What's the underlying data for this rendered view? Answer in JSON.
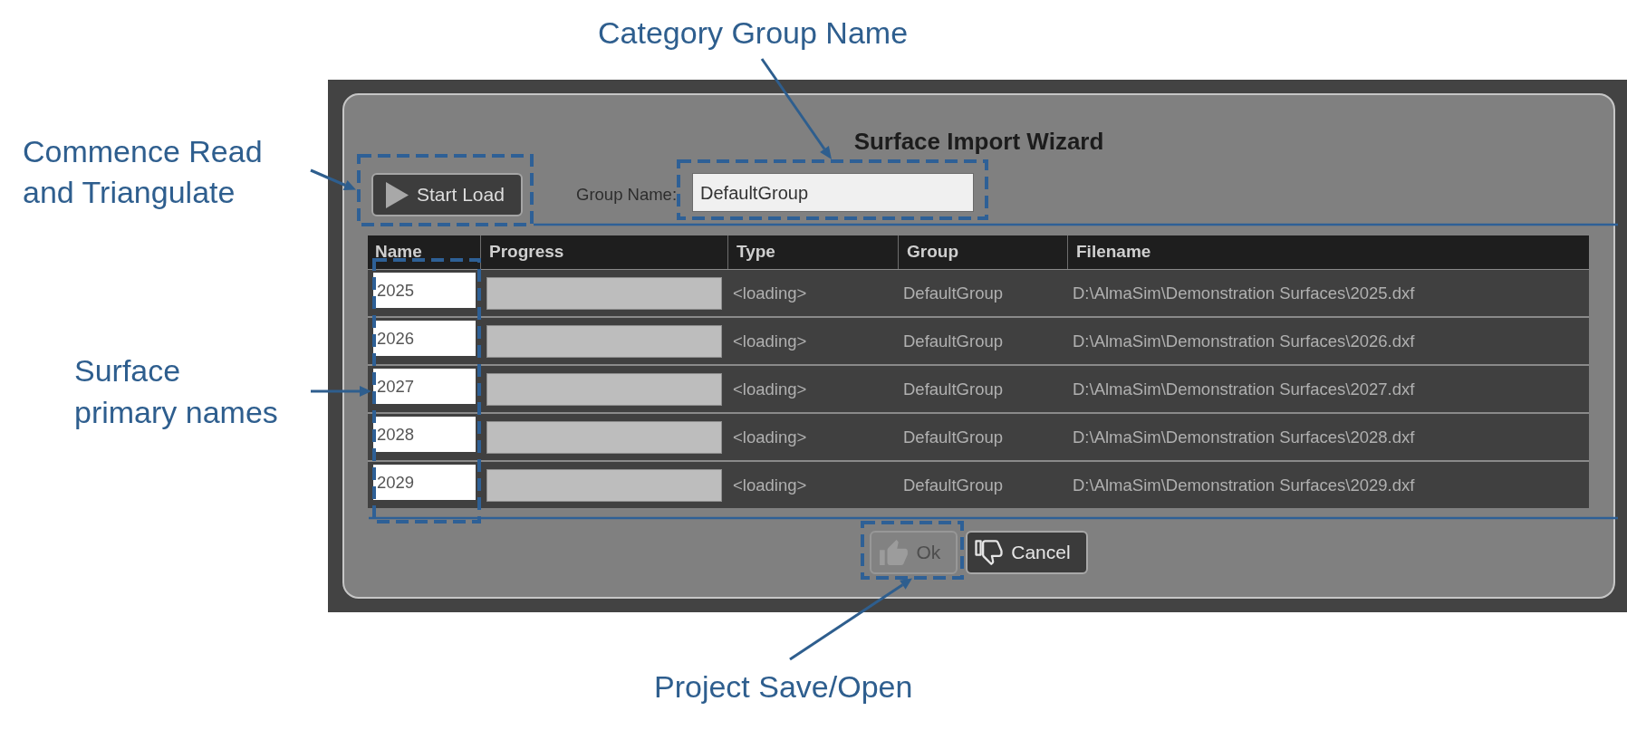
{
  "callouts": [
    {
      "text": "Category Group Name"
    },
    {
      "text": "Commence Read and Triangulate"
    },
    {
      "text": "Surface primary names"
    },
    {
      "text": "Project Save/Open"
    }
  ],
  "dialog": {
    "title": "Surface Import Wizard",
    "start_button": {
      "label": "Start Load"
    },
    "group_name": {
      "label": "Group Name:",
      "value": "DefaultGroup"
    },
    "table": {
      "columns": [
        "Name",
        "Progress",
        "Type",
        "Group",
        "Filename"
      ],
      "rows": [
        {
          "name": "2025",
          "progress": {
            "level": 0
          },
          "type": "<loading>",
          "group": "DefaultGroup",
          "filename": "D:\\AlmaSim\\Demonstration Surfaces\\2025.dxf"
        },
        {
          "name": "2026",
          "progress": {
            "level": 0
          },
          "type": "<loading>",
          "group": "DefaultGroup",
          "filename": "D:\\AlmaSim\\Demonstration Surfaces\\2026.dxf"
        },
        {
          "name": "2027",
          "progress": {
            "level": 0
          },
          "type": "<loading>",
          "group": "DefaultGroup",
          "filename": "D:\\AlmaSim\\Demonstration Surfaces\\2027.dxf"
        },
        {
          "name": "2028",
          "progress": {
            "level": 0
          },
          "type": "<loading>",
          "group": "DefaultGroup",
          "filename": "D:\\AlmaSim\\Demonstration Surfaces\\2028.dxf"
        },
        {
          "name": "2029",
          "progress": {
            "level": 0
          },
          "type": "<loading>",
          "group": "DefaultGroup",
          "filename": "D:\\AlmaSim\\Demonstration Surfaces\\2029.dxf"
        }
      ]
    },
    "buttons": [
      {
        "kind": "ok",
        "label": "Ok",
        "disabled": true
      },
      {
        "kind": "cancel",
        "label": "Cancel",
        "disabled": false
      }
    ]
  }
}
